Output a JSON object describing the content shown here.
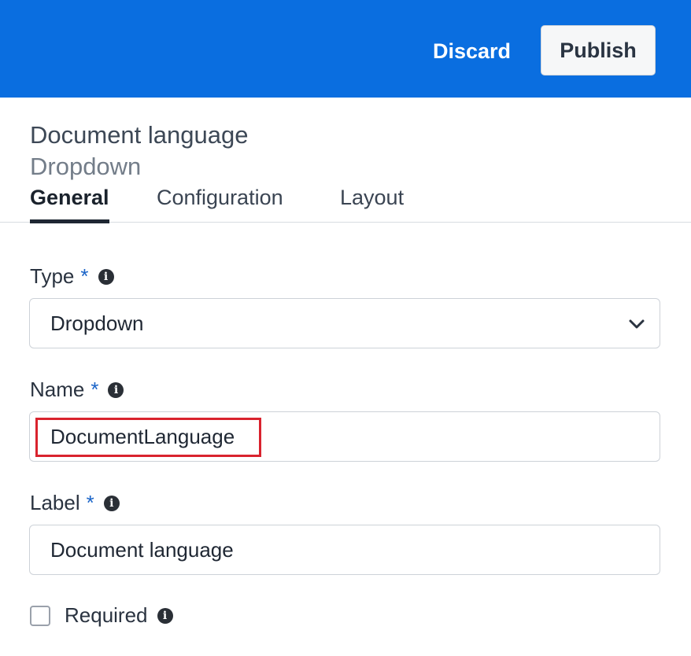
{
  "toolbar": {
    "discard_label": "Discard",
    "publish_label": "Publish"
  },
  "header": {
    "title": "Document language",
    "subtitle": "Dropdown"
  },
  "tabs": [
    {
      "label": "General",
      "active": true
    },
    {
      "label": "Configuration",
      "active": false
    },
    {
      "label": "Layout",
      "active": false
    }
  ],
  "form": {
    "type": {
      "label": "Type",
      "required_marker": "*",
      "value": "Dropdown"
    },
    "name": {
      "label": "Name",
      "required_marker": "*",
      "value": "DocumentLanguage"
    },
    "label": {
      "label": "Label",
      "required_marker": "*",
      "value": "Document language"
    },
    "required": {
      "label": "Required",
      "checked": false
    }
  },
  "icons": {
    "info": "info-icon",
    "chevron": "chevron-down-icon"
  },
  "colors": {
    "topbar": "#0a6ee0",
    "highlight": "#d9232e",
    "required_star": "#1a64c8"
  }
}
